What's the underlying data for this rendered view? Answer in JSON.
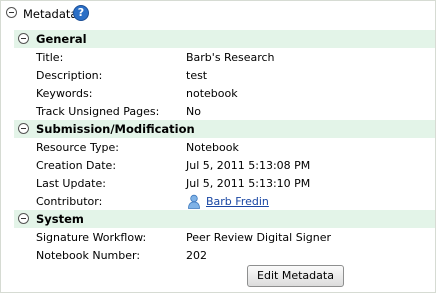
{
  "panel": {
    "title": "Metadata",
    "help_icon": "?",
    "edit_button_label": "Edit Metadata"
  },
  "sections": [
    {
      "title": "General",
      "rows": [
        {
          "label": "Title:",
          "value": "Barb's Research"
        },
        {
          "label": "Description:",
          "value": "test"
        },
        {
          "label": "Keywords:",
          "value": "notebook"
        },
        {
          "label": "Track Unsigned Pages:",
          "value": "No"
        }
      ]
    },
    {
      "title": "Submission/Modification",
      "rows": [
        {
          "label": "Resource Type:",
          "value": "Notebook"
        },
        {
          "label": "Creation Date:",
          "value": "Jul 5, 2011 5:13:08 PM"
        },
        {
          "label": "Last Update:",
          "value": "Jul 5, 2011 5:13:10 PM"
        },
        {
          "label": "Contributor:",
          "value": "Barb Fredin"
        }
      ]
    },
    {
      "title": "System",
      "rows": [
        {
          "label": "Signature Workflow:",
          "value": "Peer Review Digital Signer"
        },
        {
          "label": "Notebook Number:",
          "value": "202"
        }
      ]
    }
  ],
  "colors": {
    "section_bar": "#e3f4e8",
    "link": "#1a47a3",
    "help_icon": "#2b6fc6"
  },
  "icons": {
    "collapse": "collapse-icon",
    "help": "help-icon",
    "user": "user-icon"
  }
}
